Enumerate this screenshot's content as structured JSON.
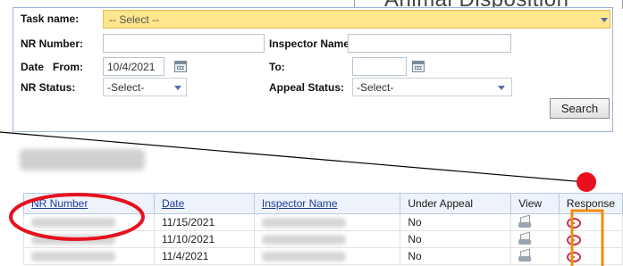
{
  "background": {
    "title": "Animal Disposition"
  },
  "search": {
    "task_label": "Task name:",
    "task_value": "-- Select --",
    "nr_number_label": "NR Number:",
    "nr_number_value": "",
    "inspector_label": "Inspector Name:",
    "inspector_value": "",
    "date_label": "Date",
    "from_label": "From:",
    "from_value": "10/4/2021",
    "to_label": "To:",
    "to_value": "",
    "nr_status_label": "NR Status:",
    "nr_status_value": "-Select-",
    "appeal_status_label": "Appeal Status:",
    "appeal_status_value": "-Select-",
    "search_button": "Search"
  },
  "results": {
    "headers": {
      "nr_number": "NR Number",
      "date": "Date",
      "inspector": "Inspector Name",
      "under_appeal": "Under Appeal",
      "view": "View",
      "response": "Response"
    },
    "rows": [
      {
        "date": "11/15/2021",
        "under_appeal": "No"
      },
      {
        "date": "11/10/2021",
        "under_appeal": "No"
      },
      {
        "date": "11/4/2021",
        "under_appeal": "No"
      }
    ]
  },
  "colors": {
    "highlight_red": "#e8101e",
    "highlight_orange": "#f08c12",
    "task_select_bg": "#ffe58c",
    "header_link": "#1e3a9e"
  },
  "icons": {
    "view": "printer-icon",
    "response": "arrow-circle-icon",
    "calendar": "calendar-icon"
  }
}
